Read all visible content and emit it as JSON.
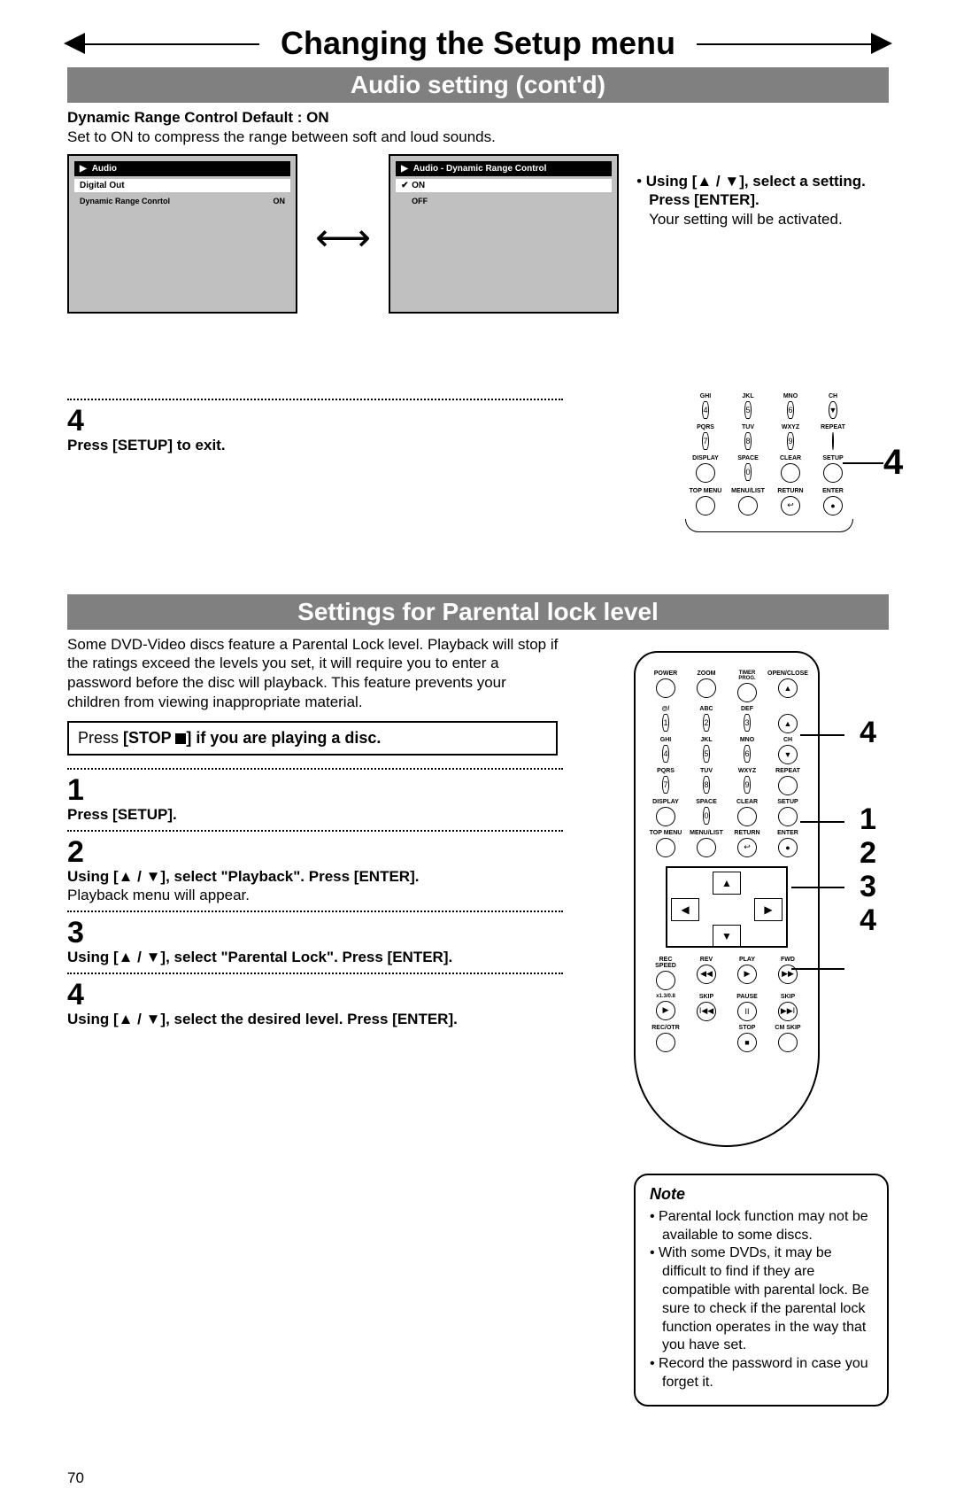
{
  "page_title": "Changing the Setup menu",
  "section1": {
    "heading": "Audio setting (cont'd)",
    "drc_heading": "Dynamic Range Control Default : ON",
    "drc_desc": "Set to ON to compress the range between soft and loud sounds.",
    "osd1": {
      "title": "Audio",
      "row1_label": "Digital Out",
      "row2_label": "Dynamic Range Conrtol",
      "row2_value": "ON"
    },
    "osd2": {
      "title": "Audio - Dynamic Range Control",
      "opt1": "ON",
      "opt2": "OFF"
    },
    "instr_bold": "Using [▲ / ▼], select a setting. Press [ENTER].",
    "instr_body": "Your setting will be activated.",
    "step4_num": "4",
    "step4_text": "Press [SETUP] to exit.",
    "remote_labels": [
      "GHI",
      "JKL",
      "MNO",
      "CH",
      "4",
      "5",
      "6",
      "",
      "PQRS",
      "TUV",
      "WXYZ",
      "REPEAT",
      "7",
      "8",
      "9",
      "",
      "DISPLAY",
      "SPACE",
      "CLEAR",
      "SETUP",
      "",
      "0",
      "",
      "",
      "TOP MENU",
      "MENU/LIST",
      "RETURN",
      "ENTER"
    ],
    "pointer4": "4"
  },
  "section2": {
    "heading": "Settings for Parental lock level",
    "intro": "Some DVD-Video discs feature a Parental Lock level. Playback will stop if the ratings exceed the levels you set, it will require you to enter a password before the disc will playback. This feature prevents your children from viewing inappropriate material.",
    "stop_pre": "Press ",
    "stop_bold": "[STOP ",
    "stop_post": "] if you are playing a disc.",
    "steps": [
      {
        "num": "1",
        "text": "Press [SETUP]."
      },
      {
        "num": "2",
        "text": "Using [▲ / ▼], select \"Playback\". Press [ENTER].",
        "sub": "Playback menu will appear."
      },
      {
        "num": "3",
        "text": "Using [▲ / ▼], select \"Parental Lock\". Press [ENTER]."
      },
      {
        "num": "4",
        "text": "Using [▲ / ▼], select the desired level. Press [ENTER]."
      }
    ],
    "note_title": "Note",
    "notes": [
      "Parental lock function may not be available to some discs.",
      "With some DVDs, it may be difficult to find if they are compatible with parental lock. Be sure to check if the parental lock function operates in the way that you have set.",
      "Record the password in case you forget it."
    ],
    "remote_top_labels": [
      "POWER",
      "",
      "TIMER PROG.",
      "OPEN/CLOSE",
      "",
      "ZOOM",
      "",
      "",
      "@/",
      "ABC",
      "DEF",
      "",
      "1",
      "2",
      "3",
      "",
      "GHI",
      "JKL",
      "MNO",
      "CH",
      "4",
      "5",
      "6",
      "",
      "PQRS",
      "TUV",
      "WXYZ",
      "REPEAT",
      "7",
      "8",
      "9",
      "",
      "DISPLAY",
      "SPACE",
      "CLEAR",
      "SETUP",
      "",
      "0",
      "",
      "",
      "TOP MENU",
      "MENU/LIST",
      "RETURN",
      "ENTER"
    ],
    "remote_bottom_labels": [
      "REC SPEED",
      "REV",
      "PLAY",
      "FWD",
      "x1.3/0.8",
      "SKIP",
      "PAUSE",
      "SKIP",
      "REC/OTR",
      "",
      "STOP",
      "CM SKIP"
    ],
    "pointers": [
      "4",
      "1",
      "2",
      "3",
      "4"
    ]
  },
  "page_number": "70"
}
